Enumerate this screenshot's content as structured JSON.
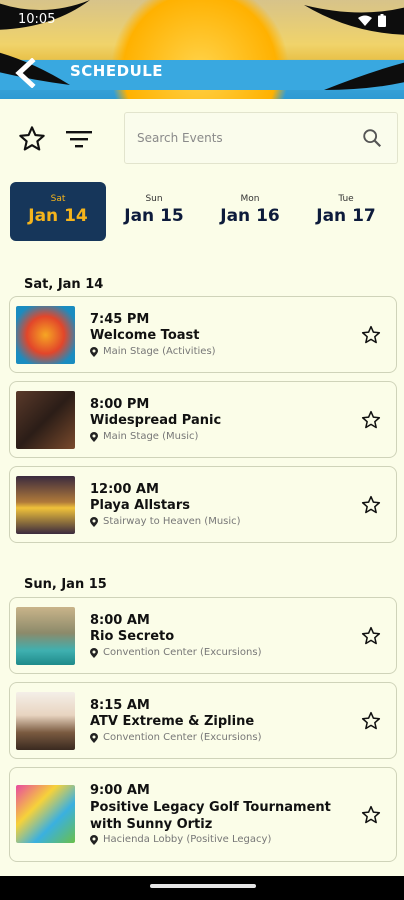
{
  "status": {
    "time": "10:05"
  },
  "header": {
    "title": "SCHEDULE"
  },
  "search": {
    "placeholder": "Search Events"
  },
  "dates": [
    {
      "dow": "Sat",
      "date": "Jan 14",
      "active": true
    },
    {
      "dow": "Sun",
      "date": "Jan 15",
      "active": false
    },
    {
      "dow": "Mon",
      "date": "Jan 16",
      "active": false
    },
    {
      "dow": "Tue",
      "date": "Jan 17",
      "active": false
    }
  ],
  "sections": [
    {
      "label": "Sat, Jan 14",
      "events": [
        {
          "time": "7:45 PM",
          "name": "Welcome Toast",
          "location": "Main Stage (Activities)"
        },
        {
          "time": "8:00 PM",
          "name": "Widespread Panic",
          "location": "Main Stage (Music)"
        },
        {
          "time": "12:00 AM",
          "name": "Playa Allstars",
          "location": "Stairway to Heaven (Music)"
        }
      ]
    },
    {
      "label": "Sun, Jan 15",
      "events": [
        {
          "time": "8:00 AM",
          "name": "Rio Secreto",
          "location": "Convention Center (Excursions)"
        },
        {
          "time": "8:15 AM",
          "name": "ATV Extreme & Zipline",
          "location": "Convention Center (Excursions)"
        },
        {
          "time": "9:00 AM",
          "name": "Positive Legacy Golf Tournament with Sunny Ortiz",
          "location": "Hacienda Lobby (Positive Legacy)"
        }
      ]
    }
  ],
  "colors": {
    "accent": "#16365a",
    "active_text": "#f5b41c",
    "background": "#fbfde8"
  }
}
